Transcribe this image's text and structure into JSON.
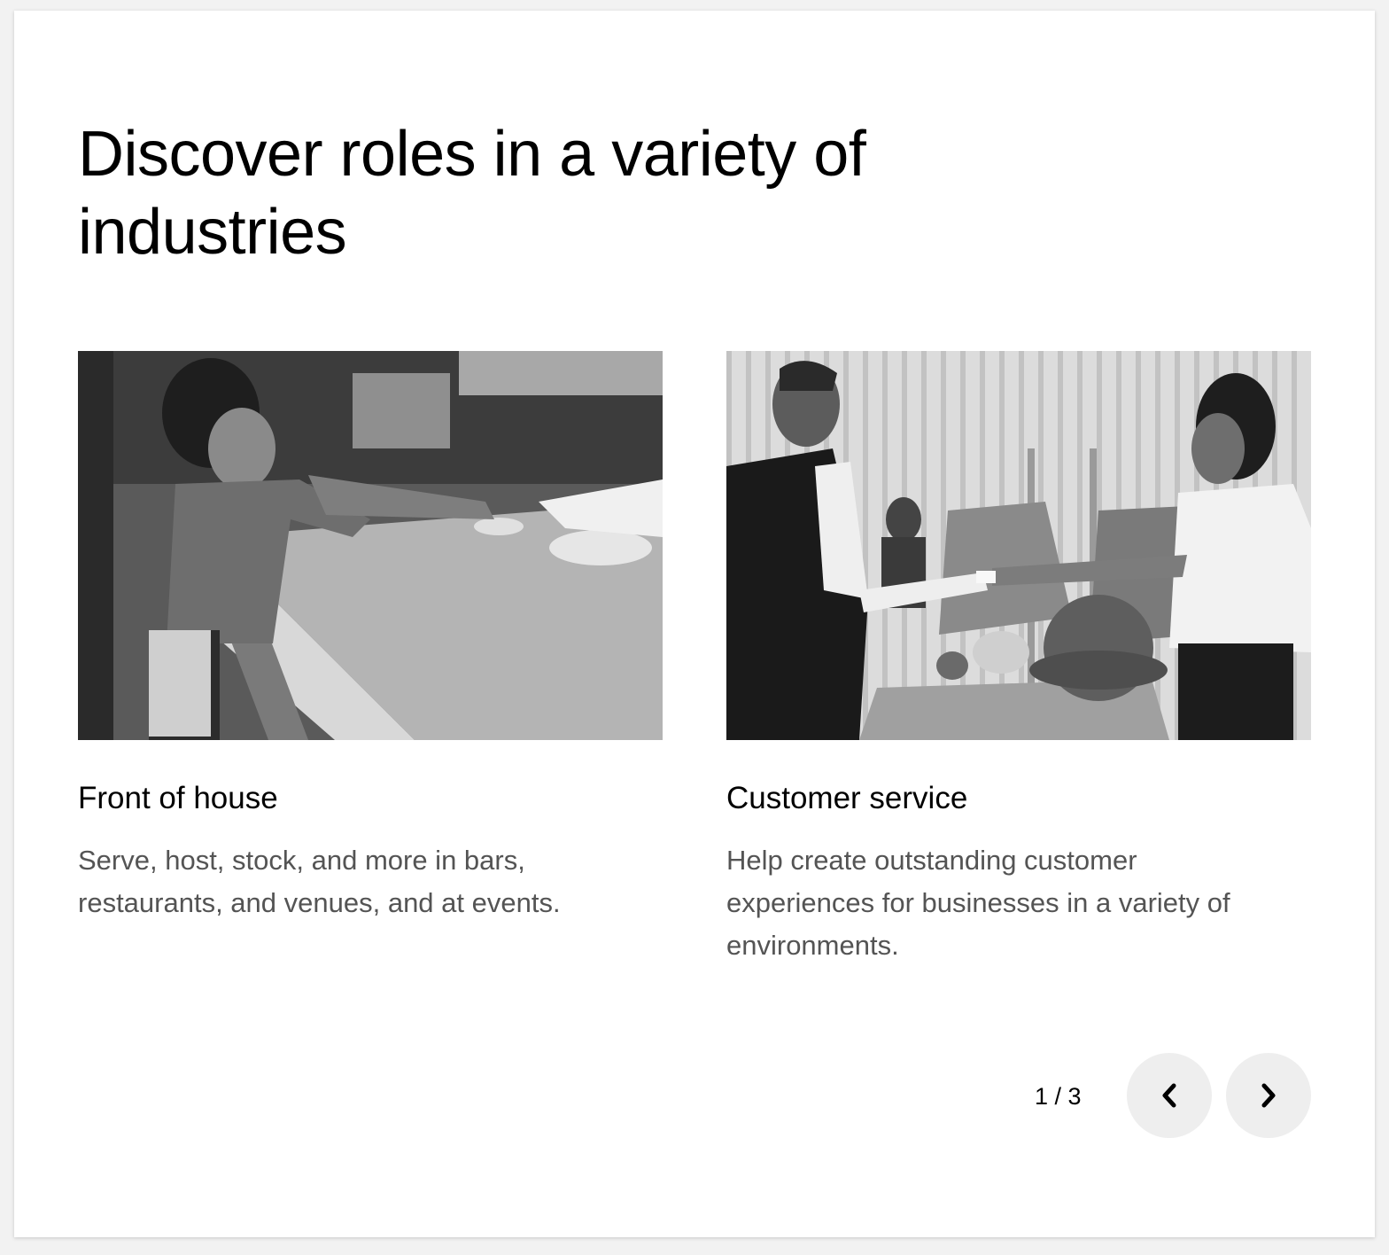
{
  "heading": "Discover roles in a variety of industries",
  "cards": [
    {
      "title": "Front of house",
      "description": "Serve, host, stock, and more in bars, restaurants, and venues, and at events.",
      "image_alt": "Bartender serving food across a counter"
    },
    {
      "title": "Customer service",
      "description": "Help create outstanding customer experiences for businesses in a variety of environments.",
      "image_alt": "Shop assistant handing a card to a customer"
    }
  ],
  "pager": {
    "text": "1 / 3",
    "prev_icon": "chevron-left-icon",
    "next_icon": "chevron-right-icon"
  },
  "colors": {
    "background": "#ffffff",
    "heading": "#000000",
    "description": "#545454",
    "button_bg": "#eeeeee"
  }
}
